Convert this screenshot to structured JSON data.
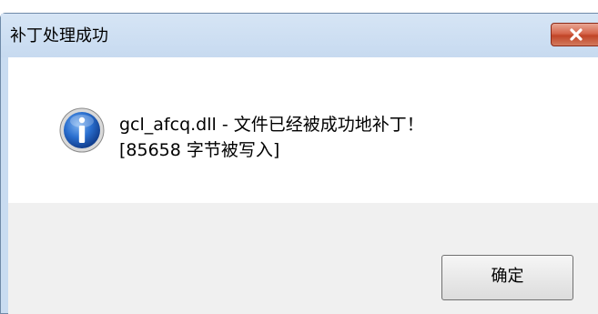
{
  "window": {
    "title": "补丁处理成功",
    "close_icon": "close-x-icon"
  },
  "message": {
    "icon": "info-icon",
    "line1": "gcl_afcq.dll -  文件已经被成功地补丁！",
    "line2": "[85658 字节被写入]"
  },
  "buttons": {
    "ok_label": "确定"
  },
  "colors": {
    "titlebar": "#c9dcf1",
    "close_button": "#c8462a",
    "footer": "#f0f0f0",
    "info_icon": "#1d5fbf"
  }
}
